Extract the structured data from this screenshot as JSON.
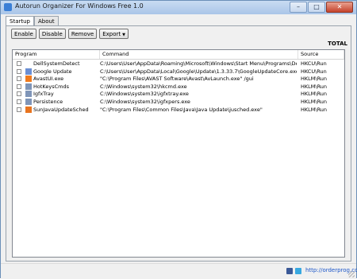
{
  "window": {
    "title": "Autorun Organizer For Windows Free 1.0",
    "controls": {
      "minimize": "–",
      "maximize": "□",
      "close": "✕"
    }
  },
  "tabs": [
    {
      "label": "Startup",
      "active": true
    },
    {
      "label": "About",
      "active": false
    }
  ],
  "toolbar": {
    "enable": "Enable",
    "disable": "Disable",
    "remove": "Remove",
    "export": "Export",
    "export_caret": "▼"
  },
  "total_label": "TOTAL",
  "table": {
    "columns": [
      "Program",
      "Command",
      "Source"
    ],
    "rows": [
      {
        "program": "DellSystemDetect",
        "command": "C:\\Users\\User\\AppData\\Roaming\\Microsoft\\Windows\\Start Menu\\Programs\\Dell\\Dell Sys...",
        "source": "HKCU\\Run",
        "icon": "blank-icon",
        "icon_color": "#ffffff"
      },
      {
        "program": "Google Update",
        "command": "C:\\Users\\User\\AppData\\Local\\Google\\Update\\1.3.33.7\\GoogleUpdateCore.exe",
        "source": "HKCU\\Run",
        "icon": "google-update-icon",
        "icon_color": "#6b8fd4"
      },
      {
        "program": "AvastUI.exe",
        "command": "\"C:\\Program Files\\AVAST Software\\Avast\\AvLaunch.exe\" /gui",
        "source": "HKLM\\Run",
        "icon": "avast-icon",
        "icon_color": "#f07b1e"
      },
      {
        "program": "HotKeysCmds",
        "command": "C:\\Windows\\system32\\hkcmd.exe",
        "source": "HKLM\\Run",
        "icon": "app-icon",
        "icon_color": "#7f95b8"
      },
      {
        "program": "IgfxTray",
        "command": "C:\\Windows\\system32\\igfxtray.exe",
        "source": "HKLM\\Run",
        "icon": "app-icon",
        "icon_color": "#7f95b8"
      },
      {
        "program": "Persistence",
        "command": "C:\\Windows\\system32\\igfxpers.exe",
        "source": "HKLM\\Run",
        "icon": "app-icon",
        "icon_color": "#7f95b8"
      },
      {
        "program": "SunJavaUpdateSched",
        "command": "\"C:\\Program Files\\Common Files\\Java\\Java Update\\jusched.exe\"",
        "source": "HKLM\\Run",
        "icon": "java-icon",
        "icon_color": "#e8741f"
      }
    ]
  },
  "status": {
    "link": "http://orderprog.com",
    "facebook_color": "#3b5998",
    "twitter_color": "#38a8e0"
  }
}
